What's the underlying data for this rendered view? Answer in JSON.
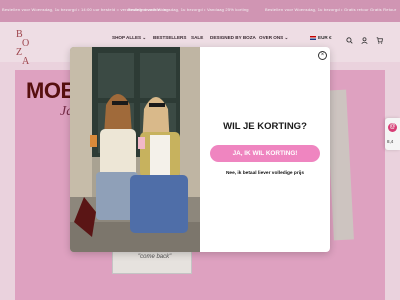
{
  "announcement": {
    "items": [
      "Bestellen voor Woensdag, 1u bezorgd • 14:00 uur besteld = verzending dezelfde dag",
      "Bestellen voor Woensdag, 1u bezorgd • Vandaag 25% korting",
      "Bestellen voor Woensdag, 1u bezorgd • Gratis retour",
      "Gratis Retour"
    ]
  },
  "header": {
    "logo_letters": [
      "B",
      "O",
      "Z",
      "A"
    ],
    "nav": [
      "SHOP ALLES",
      "BESTSELLERS",
      "SALE",
      "DESIGNED BY BOZA",
      "OVER ONS"
    ],
    "currency": "EUR €",
    "icons": [
      "search-icon",
      "user-icon",
      "cart-icon"
    ]
  },
  "page": {
    "headline": "MOED",
    "script_word": "Ja",
    "photo_caption": "\"come back\""
  },
  "review_badge": {
    "score": "8,4"
  },
  "modal": {
    "title": "WIL JE KORTING?",
    "cta": "JA, IK WIL KORTING!",
    "decline": "Nee, ik betaal liever volledige prijs",
    "close_label": "×"
  },
  "colors": {
    "accent_pink": "#ef85c0",
    "announcement_bg": "#d99cbb",
    "page_bg": "#f4dbe6",
    "hero_pink": "#e8a8c8",
    "headline_color": "#5a1010"
  }
}
